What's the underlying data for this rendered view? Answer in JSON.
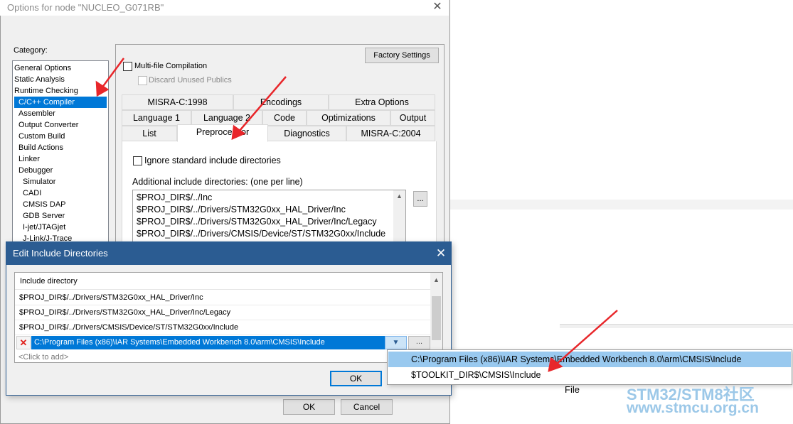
{
  "options_window": {
    "title": "Options for node \"NUCLEO_G071RB\"",
    "close_glyph": "✕",
    "category_label": "Category:",
    "categories": [
      {
        "label": "General Options",
        "indent": false,
        "selected": false
      },
      {
        "label": "Static Analysis",
        "indent": false,
        "selected": false
      },
      {
        "label": "Runtime Checking",
        "indent": false,
        "selected": false
      },
      {
        "label": "C/C++ Compiler",
        "indent": true,
        "selected": true
      },
      {
        "label": "Assembler",
        "indent": true,
        "selected": false
      },
      {
        "label": "Output Converter",
        "indent": true,
        "selected": false
      },
      {
        "label": "Custom Build",
        "indent": true,
        "selected": false
      },
      {
        "label": "Build Actions",
        "indent": true,
        "selected": false
      },
      {
        "label": "Linker",
        "indent": true,
        "selected": false
      },
      {
        "label": "Debugger",
        "indent": true,
        "selected": false
      },
      {
        "label": "Simulator",
        "indent": "deep",
        "selected": false
      },
      {
        "label": "CADI",
        "indent": "deep",
        "selected": false
      },
      {
        "label": "CMSIS DAP",
        "indent": "deep",
        "selected": false
      },
      {
        "label": "GDB Server",
        "indent": "deep",
        "selected": false
      },
      {
        "label": "I-jet/JTAGjet",
        "indent": "deep",
        "selected": false
      },
      {
        "label": "J-Link/J-Trace",
        "indent": "deep",
        "selected": false
      }
    ],
    "factory_settings_label": "Factory Settings",
    "multi_file_label": "Multi-file Compilation",
    "multi_file_checked": false,
    "discard_unused_label": "Discard Unused Publics",
    "tabs_row1": [
      "MISRA-C:1998",
      "Encodings",
      "Extra Options"
    ],
    "tabs_row2": [
      "Language 1",
      "Language 2",
      "Code",
      "Optimizations",
      "Output"
    ],
    "tabs_row3": [
      "List",
      "Preprocessor",
      "Diagnostics",
      "MISRA-C:2004"
    ],
    "active_tab": "Preprocessor",
    "ignore_std_label": "Ignore standard include directories",
    "additional_label": "Additional include directories: (one per line)",
    "include_lines": [
      "$PROJ_DIR$/../Inc",
      "$PROJ_DIR$/../Drivers/STM32G0xx_HAL_Driver/Inc",
      "$PROJ_DIR$/../Drivers/STM32G0xx_HAL_Driver/Inc/Legacy",
      "$PROJ_DIR$/../Drivers/CMSIS/Device/ST/STM32G0xx/Include"
    ],
    "browse_label": "...",
    "ok_label": "OK",
    "cancel_label": "Cancel"
  },
  "edit_dialog": {
    "title": "Edit Include Directories",
    "close_glyph": "✕",
    "column_header": "Include directory",
    "rows": [
      "$PROJ_DIR$/../Drivers/STM32G0xx_HAL_Driver/Inc",
      "$PROJ_DIR$/../Drivers/STM32G0xx_HAL_Driver/Inc/Legacy",
      "$PROJ_DIR$/../Drivers/CMSIS/Device/ST/STM32G0xx/Include"
    ],
    "editing_value": "C:\\Program Files (x86)\\IAR Systems\\Embedded Workbench 8.0\\arm\\CMSIS\\Include",
    "delete_glyph": "✕",
    "dropdown_glyph": "▼",
    "ellipsis_label": "...",
    "click_to_add": "<Click to add>",
    "ok_label": "OK"
  },
  "dropdown": {
    "options": [
      "C:\\Program Files (x86)\\IAR Systems\\Embedded Workbench 8.0\\arm\\CMSIS\\Include",
      "$TOOLKIT_DIR$\\CMSIS\\Include"
    ],
    "highlighted_index": 0
  },
  "background": {
    "file_label": "File"
  },
  "watermark": {
    "line1": "STM32/STM8社区",
    "line2": "www.stmcu.org.cn"
  },
  "colors": {
    "selection": "#0078d7",
    "dialog_title": "#2b5c92",
    "arrow": "#e8262a",
    "watermark": "#9cc8e8"
  }
}
